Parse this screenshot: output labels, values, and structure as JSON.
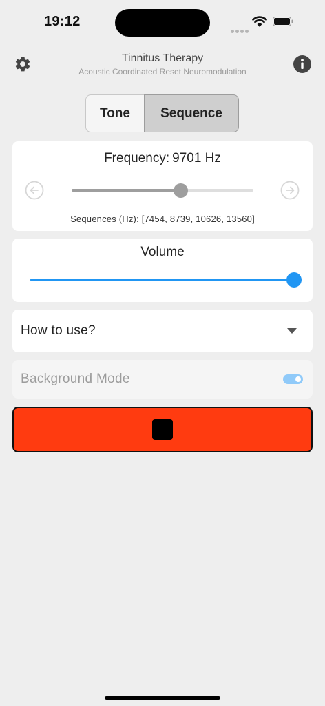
{
  "status_bar": {
    "time": "19:12"
  },
  "header": {
    "title": "Tinnitus Therapy",
    "subtitle": "Acoustic Coordinated Reset Neuromodulation",
    "settings_icon": "gear-icon",
    "info_icon": "info-icon"
  },
  "mode_selector": {
    "options": [
      "Tone",
      "Sequence"
    ],
    "selected": "Sequence"
  },
  "frequency": {
    "label": "Frequency:",
    "value": "9701 Hz",
    "slider_fraction": 0.6,
    "sequences_text": "Sequences (Hz): [7454, 8739, 10626, 13560]"
  },
  "volume": {
    "label": "Volume",
    "slider_fraction": 1.0
  },
  "how_to": {
    "label": "How to use?"
  },
  "background_mode": {
    "label": "Background Mode",
    "enabled": true
  },
  "colors": {
    "background": "#eeeeee",
    "accent_blue": "#2196f3",
    "stop_button": "#ff3b10",
    "slider_grey": "#9e9e9e"
  }
}
